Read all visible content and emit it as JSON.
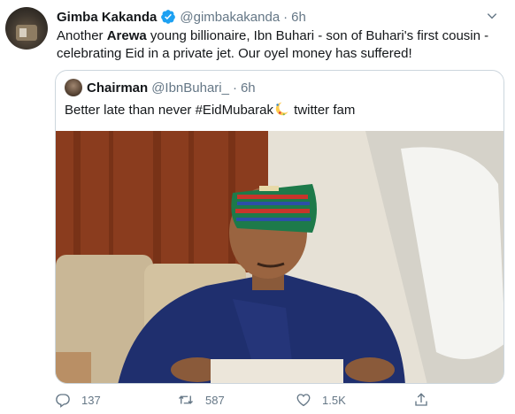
{
  "tweet": {
    "author_name": "Gimba Kakanda",
    "handle": "@gimbakakanda",
    "separator": "·",
    "time": "6h",
    "text_parts": [
      "Another ",
      "Arewa",
      " young billionaire, Ibn Buhari - son of Buhari's first cousin -",
      "celebrating Eid in a private jet. Our oyel money has suffered!"
    ],
    "icons": {
      "verified": "verified-badge-icon",
      "menu": "chevron-down-icon"
    }
  },
  "quoted": {
    "author_name": "Chairman",
    "handle": "@IbnBuhari_",
    "separator": "·",
    "time": "6h",
    "text_before": "Better late than never #EidMubarak",
    "text_after": " twitter fam",
    "emoji": "moon-icon"
  },
  "actions": {
    "reply_count": "137",
    "retweet_count": "587",
    "like_count": "1.5K",
    "icons": [
      "reply-icon",
      "retweet-icon",
      "like-icon",
      "share-icon"
    ]
  },
  "colors": {
    "accent": "#1da1f2",
    "muted": "#657786",
    "text": "#14171a",
    "border": "#ccd6dd"
  }
}
